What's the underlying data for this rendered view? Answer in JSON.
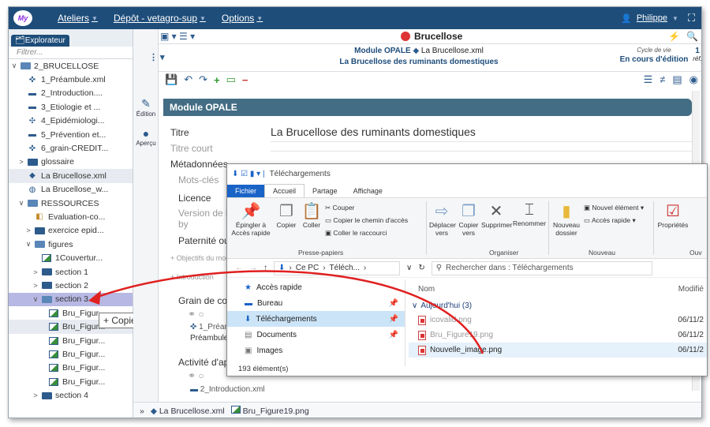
{
  "topbar": {
    "logo": "My",
    "menus": [
      "Ateliers",
      "Dépôt - vetagro-sup",
      "Options"
    ],
    "user": "Philippe"
  },
  "left": {
    "tab_label": "Explorateur",
    "filter_placeholder": "Filtrer...",
    "tree": [
      {
        "label": "2_BRUCELLOSE",
        "type": "folder-open",
        "indent": 0,
        "tw": "∨"
      },
      {
        "label": "1_Préambule.xml",
        "type": "grain",
        "indent": 1
      },
      {
        "label": "2_Introduction....",
        "type": "section",
        "indent": 1
      },
      {
        "label": "3_Etiologie et ...",
        "type": "section",
        "indent": 1
      },
      {
        "label": "4_Epidémiologi...",
        "type": "net",
        "indent": 1
      },
      {
        "label": "5_Prévention et...",
        "type": "section",
        "indent": 1
      },
      {
        "label": "6_grain-CREDIT...",
        "type": "grain",
        "indent": 1
      },
      {
        "label": "glossaire",
        "type": "folder",
        "indent": 1,
        "tw": ">"
      },
      {
        "label": "La Brucellose.xml",
        "type": "module",
        "indent": 1,
        "hl": true
      },
      {
        "label": "La Brucellose_w...",
        "type": "globe",
        "indent": 1
      },
      {
        "label": "RESSOURCES",
        "type": "folder-open",
        "indent": 1,
        "tw": "∨"
      },
      {
        "label": "Evaluation-co...",
        "type": "eval",
        "indent": 2
      },
      {
        "label": "exercice epid...",
        "type": "folder",
        "indent": 2,
        "tw": ">"
      },
      {
        "label": "figures",
        "type": "folder-open",
        "indent": 2,
        "tw": "∨"
      },
      {
        "label": "1Couvertur...",
        "type": "img",
        "indent": 3
      },
      {
        "label": "section 1",
        "type": "folder",
        "indent": 3,
        "tw": ">"
      },
      {
        "label": "section 2",
        "type": "folder",
        "indent": 3,
        "tw": ">"
      },
      {
        "label": "section 3",
        "type": "folder-open",
        "indent": 3,
        "tw": "∨",
        "sel": true
      },
      {
        "label": "Bru_Figur...",
        "type": "img",
        "indent": 4
      },
      {
        "label": "Bru_Figur...",
        "type": "img",
        "indent": 4,
        "hl": true
      },
      {
        "label": "Bru_Figur...",
        "type": "img",
        "indent": 4
      },
      {
        "label": "Bru_Figur...",
        "type": "img",
        "indent": 4
      },
      {
        "label": "Bru_Figur...",
        "type": "img",
        "indent": 4
      },
      {
        "label": "Bru_Figur...",
        "type": "img",
        "indent": 4
      },
      {
        "label": "section 4",
        "type": "folder",
        "indent": 3,
        "tw": ">"
      }
    ],
    "copy_tooltip": "+ Copier"
  },
  "vtabs": {
    "edition": "Édition",
    "apercu": "Aperçu"
  },
  "main": {
    "title": "Brucellose",
    "module_type": "Module OPALE",
    "file": "La Brucellose.xml",
    "subtitle": "La Brucellose des ruminants domestiques",
    "lifecycle_label": "Cycle de vie",
    "lifecycle_value": "En cours d'édition",
    "ref_count": "1",
    "ref_label": "réf.",
    "module_bar": "Module OPALE",
    "fields": {
      "titre_label": "Titre",
      "titre_value": "La Brucellose des ruminants domestiques",
      "titre_court": "Titre court",
      "metadonnees": "Métadonnées",
      "mots_cles": "Mots-clés",
      "licence": "Licence",
      "version": "Version de la lic",
      "by": "by",
      "paternite": "Paternité ou co",
      "objectifs": "+ Objectifs du modu",
      "introduction": "+ Introduction",
      "grain": "Grain de conter",
      "preambule_file": "1_Préaml",
      "preambule": "Préambule",
      "activite": "Activité d'appre",
      "intro_file": "2_Introduction.xml"
    }
  },
  "bottombar": {
    "item1": "La Brucellose.xml",
    "item2": "Bru_Figure19.png"
  },
  "explorer": {
    "title": "Téléchargements",
    "tabs": [
      "Fichier",
      "Accueil",
      "Partage",
      "Affichage"
    ],
    "ribbon": {
      "pin": "Épingler à Accès rapide",
      "copy": "Copier",
      "paste": "Coller",
      "cut": "Couper",
      "copy_path": "Copier le chemin d'accès",
      "paste_shortcut": "Coller le raccourci",
      "move": "Déplacer vers",
      "copy_to": "Copier vers",
      "delete": "Supprimer",
      "rename": "Renommer",
      "new_folder": "Nouveau dossier",
      "new_item": "Nouvel élément",
      "quick_access": "Accès rapide",
      "properties": "Propriétés",
      "open": "Ouv",
      "group_clipboard": "Presse-papiers",
      "group_organize": "Organiser",
      "group_new": "Nouveau"
    },
    "address": {
      "path1": "Ce PC",
      "path2": "Téléch...",
      "search": "Rechercher dans : Téléchargements"
    },
    "nav": [
      "Accès rapide",
      "Bureau",
      "Téléchargements",
      "Documents",
      "Images"
    ],
    "columns": {
      "name": "Nom",
      "modified": "Modifié"
    },
    "group": "Aujourd'hui (3)",
    "files": [
      {
        "name": "icovalid.png",
        "date": "06/11/2"
      },
      {
        "name": "Bru_Figure19.png",
        "date": "06/11/2"
      },
      {
        "name": "Nouvelle_image.png",
        "date": "06/11/2"
      }
    ],
    "status": "193 élément(s)"
  },
  "colors": {
    "brand": "#1e4d7a",
    "module_bar": "#436d84",
    "arrow": "#e02020",
    "selection": "#b7b8e3"
  }
}
